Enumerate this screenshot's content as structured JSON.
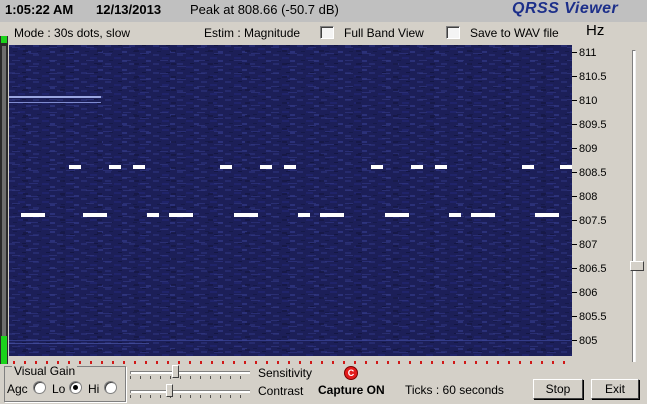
{
  "status": {
    "time": "1:05:22 AM",
    "date": "12/13/2013",
    "peak": "Peak at 808.66 (-50.7 dB)",
    "app_title": "QRSS Viewer"
  },
  "modebar": {
    "mode": "Mode : 30s dots, slow",
    "estim": "Estim : Magnitude",
    "full_band_label": "Full Band View",
    "save_wav_label": "Save to WAV file",
    "hz_label": "Hz"
  },
  "freq_axis": {
    "labels": [
      "811",
      "810.5",
      "810",
      "809.5",
      "809",
      "808.5",
      "808",
      "807.5",
      "807",
      "806.5",
      "806",
      "805.5",
      "805"
    ]
  },
  "bottom": {
    "visual_gain_title": "Visual Gain",
    "agc_label": "Agc",
    "lo_label": "Lo",
    "hi_label": "Hi",
    "selected_gain": "Lo",
    "sensitivity_label": "Sensitivity",
    "contrast_label": "Contrast",
    "capture_icon_text": "C",
    "capture_label": "Capture ON",
    "ticks_label": "Ticks   : 60 seconds",
    "stop_label": "Stop",
    "exit_label": "Exit"
  },
  "colors": {
    "spectrogram_bg": "#1c1f58",
    "trace": "#ffffff",
    "tick_marks": "#d01818",
    "title_blue": "#1c2f8a"
  }
}
